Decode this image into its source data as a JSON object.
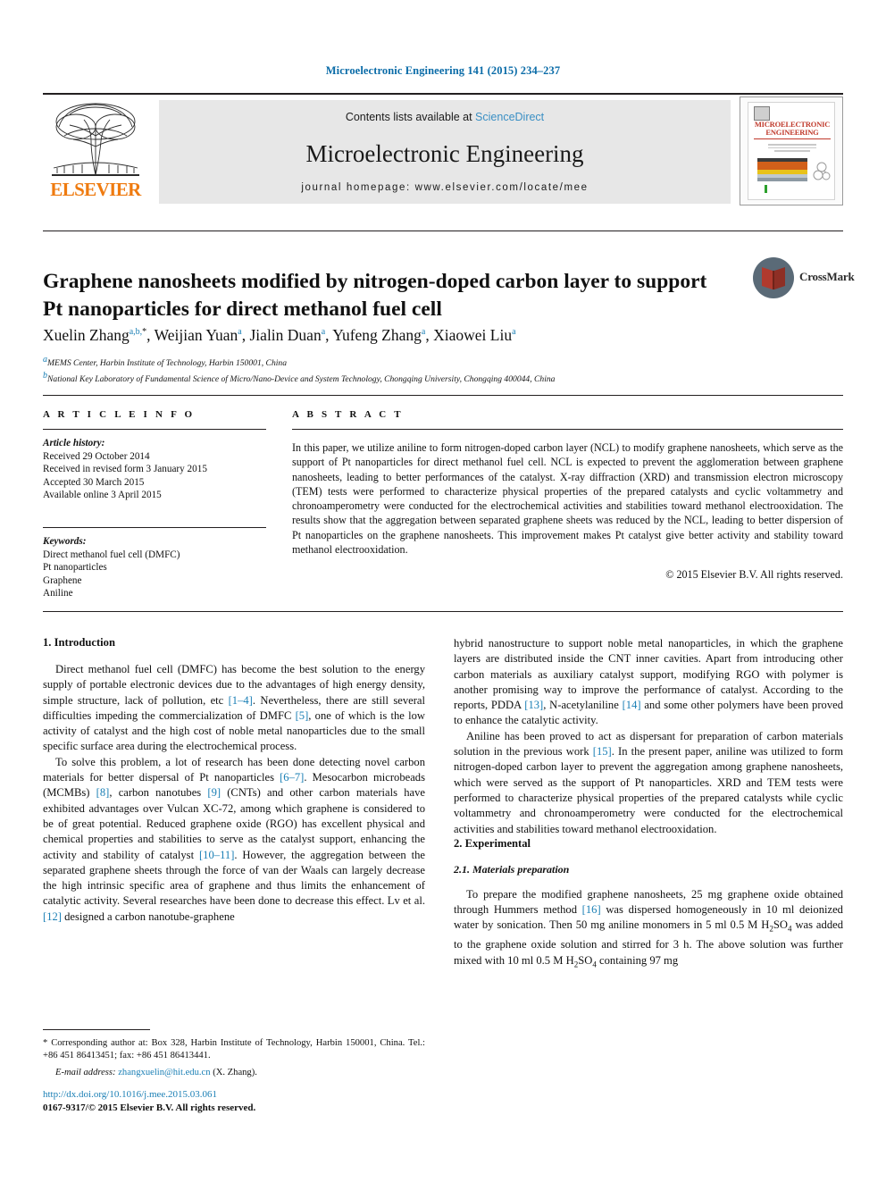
{
  "running_head": "Microelectronic Engineering 141 (2015) 234–237",
  "header": {
    "publisher_name": "ELSEVIER",
    "contents_prefix": "Contents lists available at ",
    "contents_link": "ScienceDirect",
    "journal_title": "Microelectronic Engineering",
    "homepage": "journal homepage: www.elsevier.com/locate/mee",
    "cover_title_line1": "MICROELECTRONIC",
    "cover_title_line2": "ENGINEERING"
  },
  "title": "Graphene nanosheets modified by nitrogen-doped carbon layer to support Pt nanoparticles for direct methanol fuel cell",
  "crossmark_label": "CrossMark",
  "authors": [
    {
      "name": "Xuelin Zhang",
      "marks": "a,b,",
      "star": "*",
      "sep": ", "
    },
    {
      "name": "Weijian Yuan",
      "marks": "a",
      "star": "",
      "sep": ", "
    },
    {
      "name": "Jialin Duan",
      "marks": "a",
      "star": "",
      "sep": ", "
    },
    {
      "name": "Yufeng Zhang",
      "marks": "a",
      "star": "",
      "sep": ", "
    },
    {
      "name": "Xiaowei Liu",
      "marks": "a",
      "star": "",
      "sep": ""
    }
  ],
  "affiliations": [
    {
      "mark": "a",
      "text": "MEMS Center, Harbin Institute of Technology, Harbin 150001, China"
    },
    {
      "mark": "b",
      "text": "National Key Laboratory of Fundamental Science of Micro/Nano-Device and System Technology, Chongqing University, Chongqing 400044, China"
    }
  ],
  "article_info": {
    "heading": "A R T I C L E  I N F O",
    "history_label": "Article history:",
    "history": [
      "Received 29 October 2014",
      "Received in revised form 3 January 2015",
      "Accepted 30 March 2015",
      "Available online 3 April 2015"
    ],
    "keywords_label": "Keywords:",
    "keywords": [
      "Direct methanol fuel cell (DMFC)",
      "Pt nanoparticles",
      "Graphene",
      "Aniline"
    ]
  },
  "abstract": {
    "heading": "A B S T R A C T",
    "text": "In this paper, we utilize aniline to form nitrogen-doped carbon layer (NCL) to modify graphene nanosheets, which serve as the support of Pt nanoparticles for direct methanol fuel cell. NCL is expected to prevent the agglomeration between graphene nanosheets, leading to better performances of the catalyst. X-ray diffraction (XRD) and transmission electron microscopy (TEM) tests were performed to characterize physical properties of the prepared catalysts and cyclic voltammetry and chronoamperometry were conducted for the electrochemical activities and stabilities toward methanol electrooxidation. The results show that the aggregation between separated graphene sheets was reduced by the NCL, leading to better dispersion of Pt nanoparticles on the graphene nanosheets. This improvement makes Pt catalyst give better activity and stability toward methanol electrooxidation.",
    "copyright": "© 2015 Elsevier B.V. All rights reserved."
  },
  "body": {
    "intro_heading": "1. Introduction",
    "intro_p1_a": "Direct methanol fuel cell (DMFC) has become the best solution to the energy supply of portable electronic devices due to the advantages of high energy density, simple structure, lack of pollution, etc ",
    "intro_p1_ref1": "[1–4]",
    "intro_p1_b": ". Nevertheless, there are still several difficulties impeding the commercialization of DMFC ",
    "intro_p1_ref2": "[5]",
    "intro_p1_c": ", one of which is the low activity of catalyst and the high cost of noble metal nanoparticles due to the small specific surface area during the electrochemical process.",
    "intro_p2_a": "To solve this problem, a lot of research has been done detecting novel carbon materials for better dispersal of Pt nanoparticles ",
    "intro_p2_ref1": "[6–7]",
    "intro_p2_b": ". Mesocarbon microbeads (MCMBs) ",
    "intro_p2_ref2": "[8]",
    "intro_p2_c": ", carbon nanotubes ",
    "intro_p2_ref3": "[9]",
    "intro_p2_d": " (CNTs) and other carbon materials have exhibited advantages over Vulcan XC-72, among which graphene is considered to be of great potential. Reduced graphene oxide (RGO) has excellent physical and chemical properties and stabilities to serve as the catalyst support, enhancing the activity and stability of catalyst ",
    "intro_p2_ref4": "[10–11]",
    "intro_p2_e": ". However, the aggregation between the separated graphene sheets through the force of van der Waals can largely decrease the high intrinsic specific area of graphene and thus limits the enhancement of catalytic activity. Several researches have been done to decrease this effect. Lv et al. ",
    "intro_p2_ref5": "[12]",
    "intro_p2_f": " designed a carbon nanotube-graphene",
    "right_p1_a": "hybrid nanostructure to support noble metal nanoparticles, in which the graphene layers are distributed inside the CNT inner cavities. Apart from introducing other carbon materials as auxiliary catalyst support, modifying RGO with polymer is another promising way to improve the performance of catalyst. According to the reports, PDDA ",
    "right_p1_ref1": "[13]",
    "right_p1_b": ", N-acetylaniline ",
    "right_p1_ref2": "[14]",
    "right_p1_c": " and some other polymers have been proved to enhance the catalytic activity.",
    "right_p2_a": "Aniline has been proved to act as dispersant for preparation of carbon materials solution in the previous work ",
    "right_p2_ref1": "[15]",
    "right_p2_b": ". In the present paper, aniline was utilized to form nitrogen-doped carbon layer to prevent the aggregation among graphene nanosheets, which were served as the support of Pt nanoparticles. XRD and TEM tests were performed to characterize physical properties of the prepared catalysts while cyclic voltammetry and chronoamperometry were conducted for the electrochemical activities and stabilities toward methanol electrooxidation.",
    "exp_heading": "2. Experimental",
    "exp_subheading": "2.1. Materials preparation",
    "exp_p1_a": "To prepare the modified graphene nanosheets, 25 mg graphene oxide obtained through Hummers method ",
    "exp_p1_ref1": "[16]",
    "exp_p1_b": " was dispersed homogeneously in 10 ml deionized water by sonication. Then 50 mg aniline monomers in 5 ml 0.5 M H",
    "exp_p1_sub1": "2",
    "exp_p1_c": "SO",
    "exp_p1_sub2": "4",
    "exp_p1_d": " was added to the graphene oxide solution and stirred for 3 h. The above solution was further mixed with 10 ml 0.5 M H",
    "exp_p1_sub3": "2",
    "exp_p1_e": "SO",
    "exp_p1_sub4": "4",
    "exp_p1_f": " containing 97 mg"
  },
  "footnote": {
    "star": "*",
    "text": " Corresponding author at: Box 328, Harbin Institute of Technology, Harbin 150001, China. Tel.: +86 451 86413451; fax: +86 451 86413441.",
    "email_label": "E-mail address:",
    "email": "zhangxuelin@hit.edu.cn",
    "email_suffix": " (X. Zhang)."
  },
  "footer": {
    "doi": "http://dx.doi.org/10.1016/j.mee.2015.03.061",
    "copyright": "0167-9317/© 2015 Elsevier B.V. All rights reserved."
  },
  "colors": {
    "link_blue": "#1a7fb5",
    "elsevier_orange": "#ef7b10",
    "header_grey": "#e7e7e7"
  }
}
